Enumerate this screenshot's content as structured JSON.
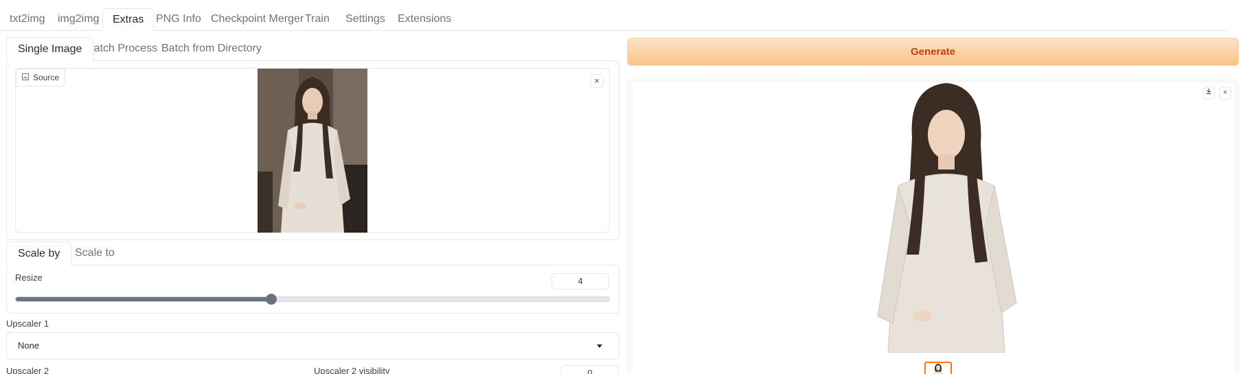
{
  "tabs": [
    "txt2img",
    "img2img",
    "Extras",
    "PNG Info",
    "Checkpoint Merger",
    "Train",
    "Settings",
    "Extensions"
  ],
  "active_tab": "Extras",
  "extras": {
    "mode_tabs": [
      "Single Image",
      "Batch Process",
      "Batch from Directory"
    ],
    "active_mode": "Single Image",
    "source_label": "Source",
    "scale_tabs": [
      "Scale by",
      "Scale to"
    ],
    "active_scale": "Scale by",
    "resize_label": "Resize",
    "resize_value": "4",
    "resize_slider_fraction": 0.43,
    "upscaler1_label": "Upscaler 1",
    "upscaler1_value": "None",
    "upscaler2_label": "Upscaler 2",
    "upscaler2_visibility_label": "Upscaler 2 visibility",
    "upscaler2_visibility_value": "0"
  },
  "output": {
    "generate_label": "Generate"
  },
  "icons": {
    "close": "×",
    "download": "download-icon",
    "image": "image-icon"
  },
  "colors": {
    "accent": "#f97316",
    "generate_text": "#c2410c"
  }
}
